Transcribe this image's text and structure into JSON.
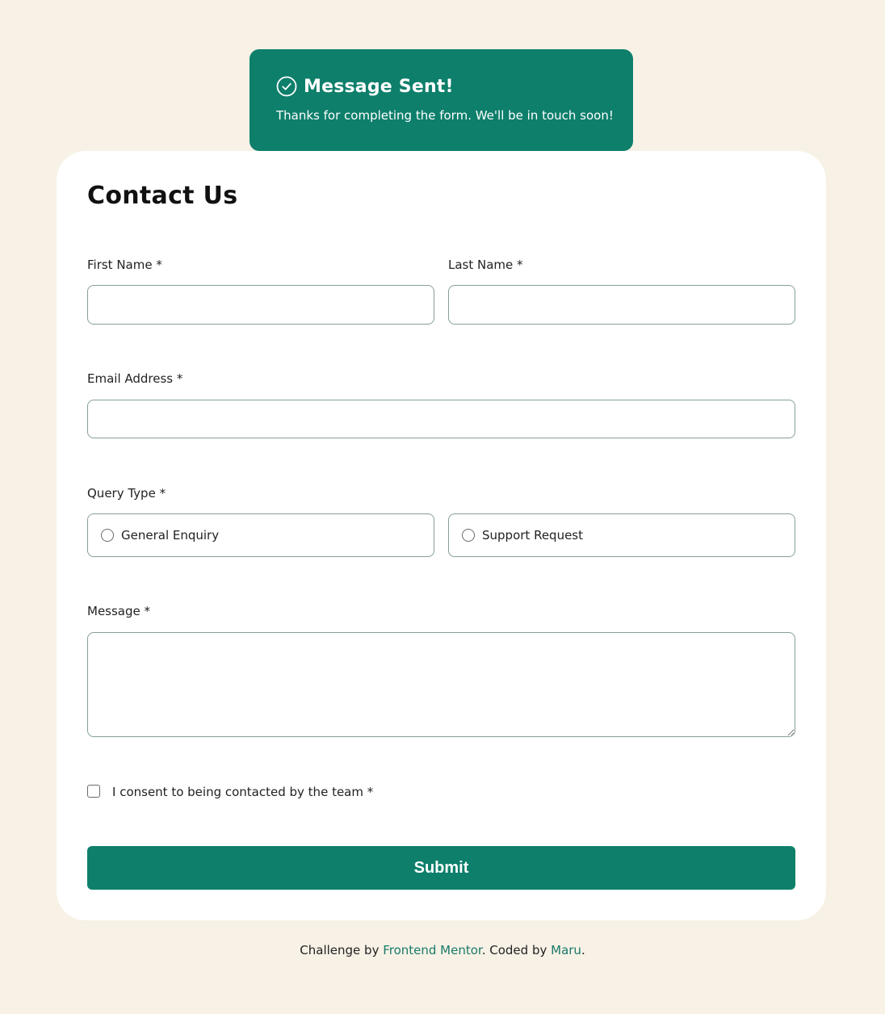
{
  "toast": {
    "icon": "check-circle-icon",
    "title": "Message Sent!",
    "text": "Thanks for completing the form. We'll be in touch soon!"
  },
  "form": {
    "title": "Contact Us",
    "first_name_label": "First Name *",
    "first_name_value": "",
    "last_name_label": "Last Name *",
    "last_name_value": "",
    "email_label": "Email Address *",
    "email_value": "",
    "query_type_label": "Query Type *",
    "query_options": [
      {
        "label": "General Enquiry",
        "selected": false
      },
      {
        "label": "Support Request",
        "selected": false
      }
    ],
    "message_label": "Message *",
    "message_value": "",
    "consent_label": "I consent to being contacted by the team *",
    "consent_checked": false,
    "submit_label": "Submit"
  },
  "footer": {
    "prefix": "Challenge by ",
    "challenge_link": "Frontend Mentor",
    "middle": ". Coded by ",
    "author_link": "Maru",
    "suffix": "."
  },
  "colors": {
    "background": "#f7f1e6",
    "accent": "#0d7f6b",
    "card": "#ffffff",
    "border": "#86a09a"
  }
}
